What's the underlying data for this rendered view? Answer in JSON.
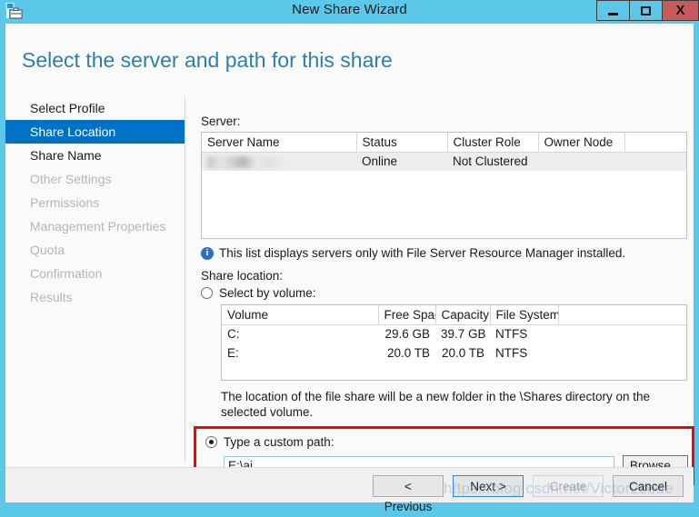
{
  "window": {
    "title": "New Share Wizard",
    "icon": "share-wizard-icon",
    "accent_color": "#5BC8EA",
    "controls": {
      "minimize": "–",
      "maximize": "□",
      "close": "X"
    }
  },
  "page": {
    "heading": "Select the server and path for this share"
  },
  "sidebar": {
    "items": [
      {
        "label": "Select Profile",
        "state": "enabled"
      },
      {
        "label": "Share Location",
        "state": "active"
      },
      {
        "label": "Share Name",
        "state": "enabled"
      },
      {
        "label": "Other Settings",
        "state": "disabled"
      },
      {
        "label": "Permissions",
        "state": "disabled"
      },
      {
        "label": "Management Properties",
        "state": "disabled"
      },
      {
        "label": "Quota",
        "state": "disabled"
      },
      {
        "label": "Confirmation",
        "state": "disabled"
      },
      {
        "label": "Results",
        "state": "disabled"
      }
    ],
    "active_color": "#0072C6"
  },
  "server_section": {
    "label": "Server:",
    "columns": [
      "Server Name",
      "Status",
      "Cluster Role",
      "Owner Node"
    ],
    "rows": [
      {
        "server_name": "",
        "server_name_redacted": true,
        "status": "Online",
        "cluster_role": "Not Clustered",
        "owner_node": "",
        "selected": true
      }
    ],
    "info_message": "This list displays servers only with File Server Resource Manager installed.",
    "info_icon": "info-icon"
  },
  "share_location": {
    "label": "Share location:",
    "select_by_volume": {
      "label": "Select by volume:",
      "checked": false
    },
    "volume_columns": [
      "Volume",
      "Free Space",
      "Capacity",
      "File System"
    ],
    "volume_rows": [
      {
        "volume": "C:",
        "free_space": "29.6 GB",
        "capacity": "39.7 GB",
        "file_system": "NTFS"
      },
      {
        "volume": "E:",
        "free_space": "20.0 TB",
        "capacity": "20.0 TB",
        "file_system": "NTFS"
      }
    ],
    "helper_text": "The location of the file share will be a new folder in the \\Shares directory on the selected volume.",
    "custom_path": {
      "label": "Type a custom path:",
      "checked": true,
      "value": "E:\\ai",
      "placeholder": "",
      "browse_label": "Browse...",
      "highlight_color": "#FF0000"
    }
  },
  "footer": {
    "previous_label": "< Previous",
    "next_label": "Next >",
    "create_label": "Create",
    "cancel_label": "Cancel"
  },
  "watermark": {
    "text": "https://blog.csdn.net/Victor2code"
  }
}
